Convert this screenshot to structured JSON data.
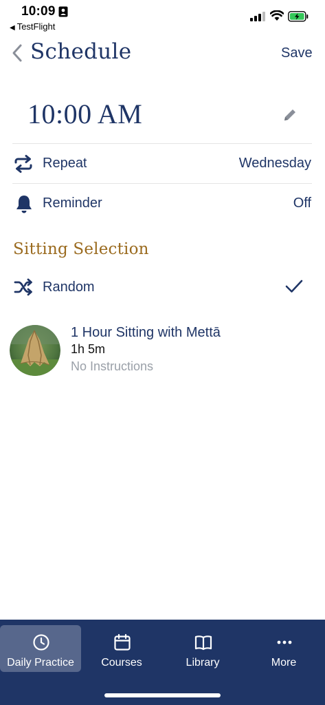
{
  "status_bar": {
    "time": "10:09",
    "back_app": "TestFlight"
  },
  "nav": {
    "back_icon": "chevron-left-icon",
    "title": "Schedule",
    "save_label": "Save"
  },
  "schedule": {
    "time": "10:00 AM",
    "edit_icon": "pencil-icon",
    "repeat": {
      "label": "Repeat",
      "value": "Wednesday",
      "icon": "repeat-icon"
    },
    "reminder": {
      "label": "Reminder",
      "value": "Off",
      "icon": "bell-icon"
    }
  },
  "sitting_selection": {
    "title": "Sitting Selection",
    "random": {
      "label": "Random",
      "icon": "shuffle-icon",
      "checked": true
    },
    "item": {
      "title": "1 Hour Sitting with Mettā",
      "duration": "1h 5m",
      "subtitle": "No Instructions"
    }
  },
  "tabs": [
    {
      "label": "Daily Practice",
      "icon": "clock-icon",
      "active": true
    },
    {
      "label": "Courses",
      "icon": "calendar-icon",
      "active": false
    },
    {
      "label": "Library",
      "icon": "book-icon",
      "active": false
    },
    {
      "label": "More",
      "icon": "more-icon",
      "active": false
    }
  ],
  "colors": {
    "primary": "#1f3566",
    "accent_gold": "#9a6a1e",
    "muted": "#9aa0a8",
    "battery_green": "#34c759"
  }
}
